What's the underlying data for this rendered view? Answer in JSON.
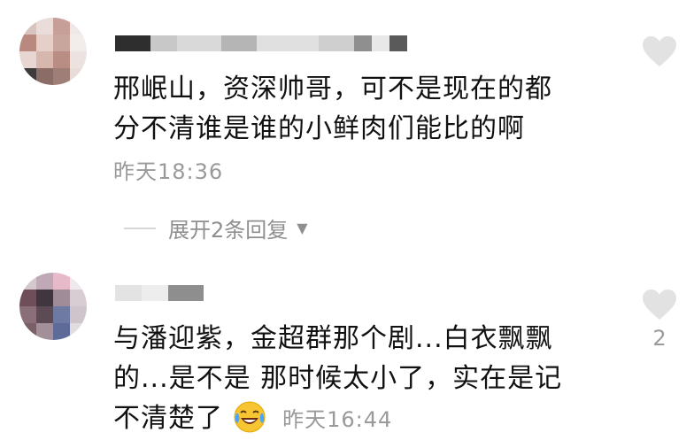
{
  "comments": [
    {
      "text_line1": "邢岷山，资深帅哥，可不是现在的都",
      "text_line2": "分不清谁是谁的小鲜肉们能比的啊",
      "time": "昨天18:36",
      "like_count": ""
    },
    {
      "text_line1": "与潘迎紫，金超群那个剧...白衣飘飘",
      "text_line2": "的...是不是 那时候太小了，实在是记",
      "text_line3": "不清楚了",
      "time": "昨天16:44",
      "like_count": "2"
    }
  ],
  "expand_label": "展开2条回复",
  "icons": {
    "like": "heart-icon",
    "expand_arrow": "triangle-down-icon",
    "emoji": "laughing-crying-emoji-icon"
  },
  "colors": {
    "text": "#111111",
    "meta": "#9a9a9a",
    "heart": "#e2e2e2"
  }
}
